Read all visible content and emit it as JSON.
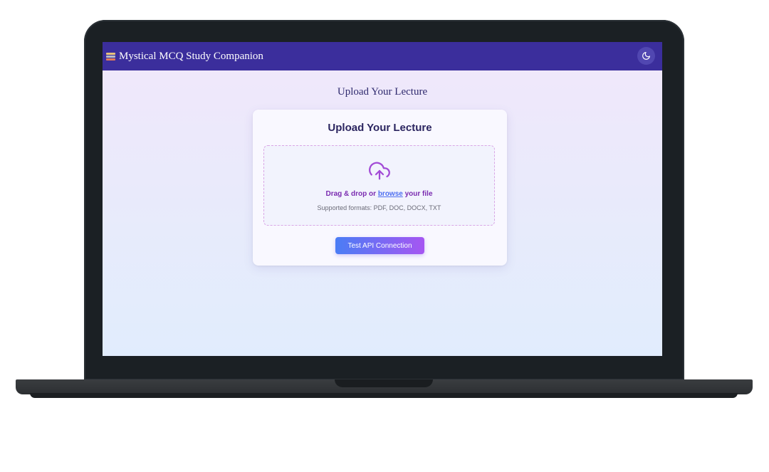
{
  "header": {
    "title": "Mystical MCQ Study Companion",
    "logo_icon": "stacked-books-icon",
    "theme_toggle_icon": "moon-icon",
    "background_color": "#3b2e9c"
  },
  "page": {
    "heading": "Upload Your Lecture"
  },
  "upload_card": {
    "title": "Upload Your Lecture",
    "upload_icon": "cloud-upload-icon",
    "drop_prefix": "Drag & drop or ",
    "browse_label": "browse",
    "drop_suffix": " your file",
    "supported_formats": "Supported formats: PDF, DOC, DOCX, TXT",
    "test_button_label": "Test API Connection",
    "accent_color": "#a656f2"
  }
}
